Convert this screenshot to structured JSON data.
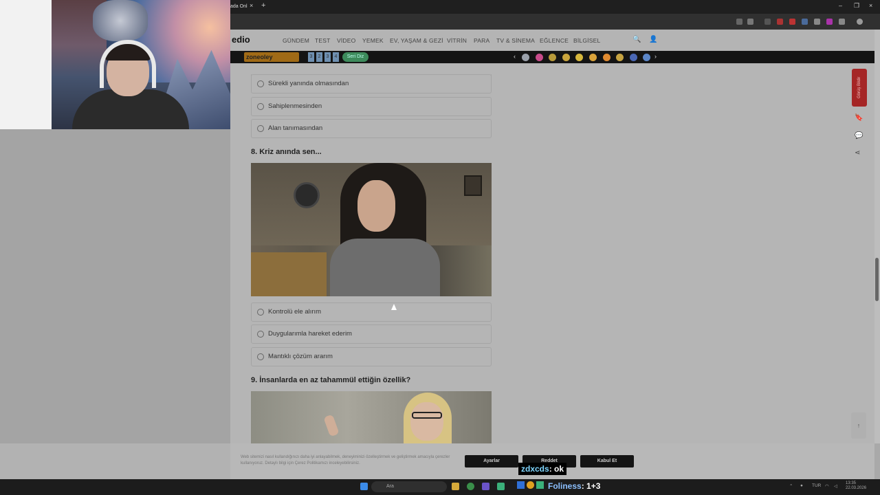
{
  "browser": {
    "tab_title": "ada Onl",
    "tab_close": "×",
    "new_tab": "+",
    "win_min": "–",
    "win_max": "❐",
    "win_close": "×"
  },
  "site": {
    "logo": "edio",
    "nav": [
      "GÜNDEM",
      "TEST",
      "VİDEO",
      "YEMEK",
      "EV, YAŞAM & GEZİ",
      "VİTRİN",
      "PARA",
      "TV & SİNEMA",
      "EĞLENCE",
      "BİLGİSEL"
    ],
    "search_icon": "🔍",
    "user_icon": "👤"
  },
  "game_bar": {
    "zone_label": "zoneoley",
    "numbers": [
      "3",
      "2",
      "3",
      "4"
    ],
    "seri_label": "Seri Diz",
    "prev": "‹",
    "next": "›",
    "emoji_colors": [
      "#9aa0aa",
      "#c84b8a",
      "#b89a3a",
      "#c9a43c",
      "#d6b73c",
      "#d9a23a",
      "#e08a30",
      "#c6a341",
      "#4a67b4",
      "#5b86c8"
    ]
  },
  "quiz": {
    "prev_options": [
      "Sürekli yanında olmasından",
      "Sahiplenmesinden",
      "Alan tanımasından"
    ],
    "q8_title": "8. Kriz anında sen...",
    "q8_options": [
      "Kontrolü ele alırım",
      "Duygularımla hareket ederim",
      "Mantıklı çözüm ararım"
    ],
    "q9_title": "9. İnsanlarda en az tahammül ettiğin özellik?"
  },
  "sidebar": {
    "feedback": "Görüş Bildir",
    "bookmark_icon": "🔖",
    "comment_icon": "💬",
    "share_icon": "⋖",
    "top_icon": "↑"
  },
  "cookie": {
    "text": "Web sitemizi nasıl kullandığınızı daha iyi anlayabilmek, deneyiminizi özelleştirmek ve geliştirmek amacıyla çerezler kullanıyoruz. Detaylı bilgi için Çerez Politikamızı inceleyebilirsiniz.",
    "settings": "Ayarlar",
    "reject": "Reddet",
    "accept": "Kabul Et"
  },
  "overlay": {
    "chat_user": "zdxcds",
    "chat_msg": ": ok",
    "foliness_name": "Foliness",
    "foliness_msg": ": 1+3"
  },
  "taskbar": {
    "search": "Ara",
    "lang": "TUR",
    "time": "13:35",
    "date": "22.03.2026"
  }
}
